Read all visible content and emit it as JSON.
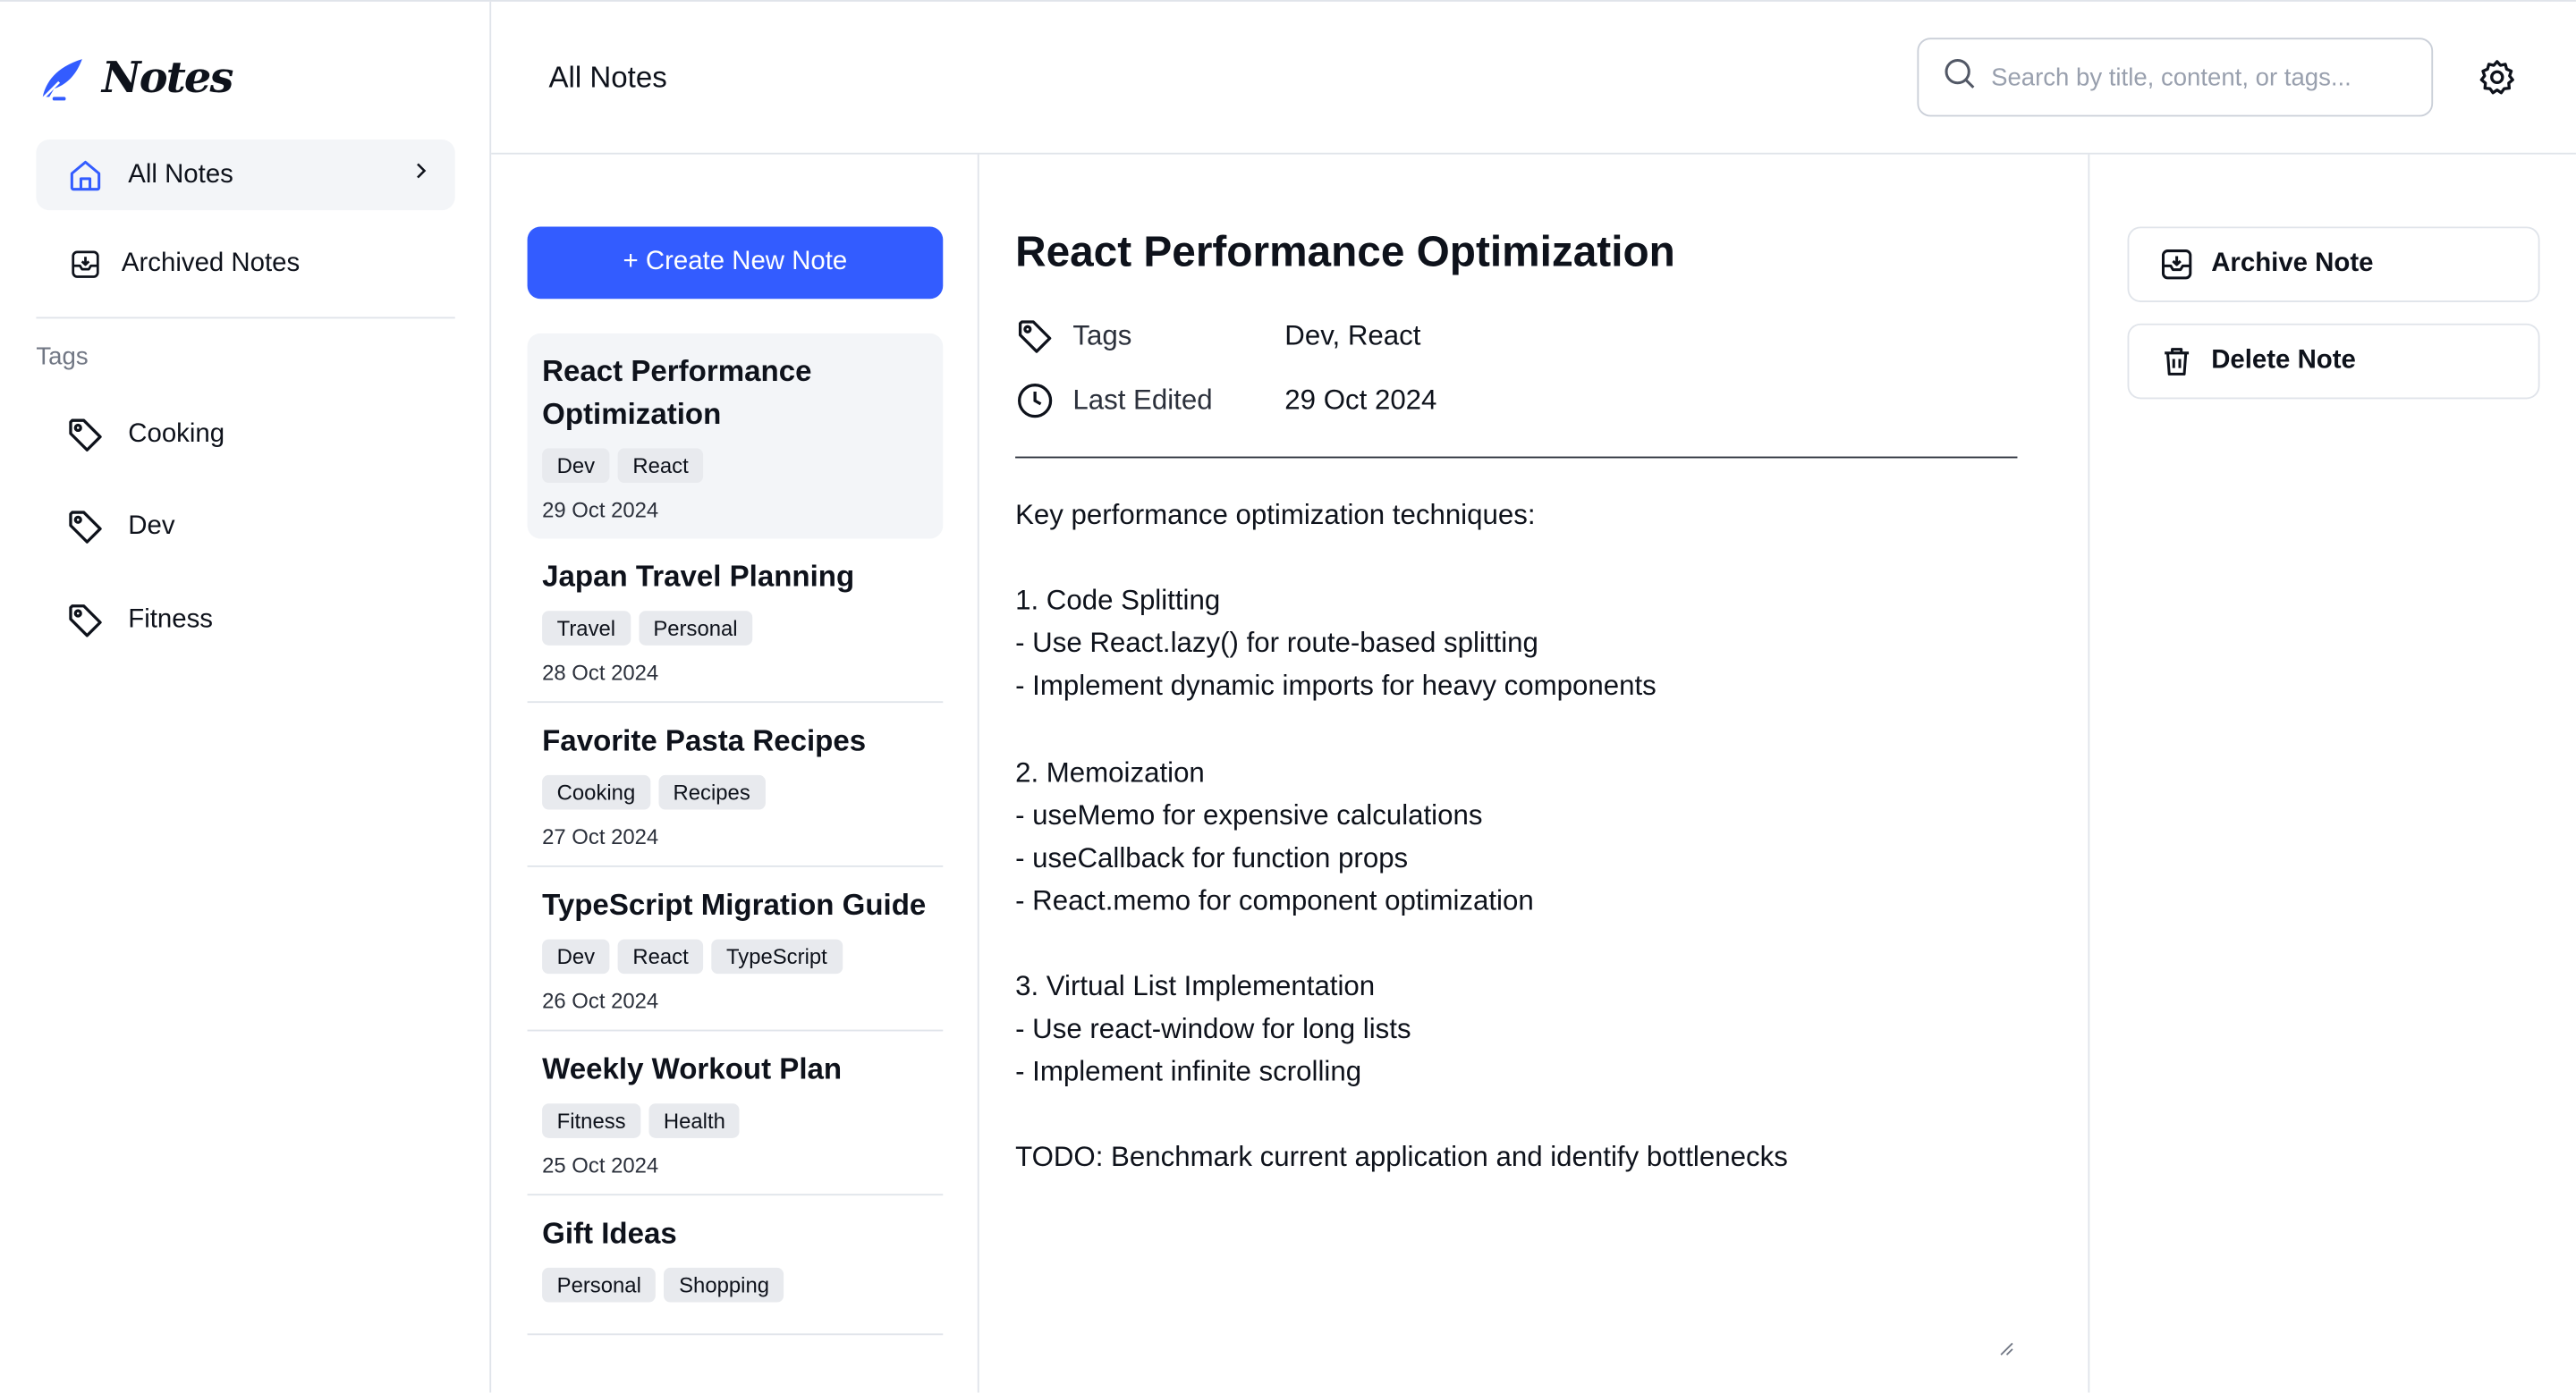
{
  "app": {
    "logo_text": "Notes"
  },
  "sidebar": {
    "nav": [
      {
        "label": "All Notes",
        "icon": "home-icon",
        "active": true
      },
      {
        "label": "Archived Notes",
        "icon": "archive-icon",
        "active": false
      }
    ],
    "tags_label": "Tags",
    "tags": [
      {
        "label": "Cooking",
        "icon": "tag-icon"
      },
      {
        "label": "Dev",
        "icon": "tag-icon"
      },
      {
        "label": "Fitness",
        "icon": "tag-icon"
      }
    ]
  },
  "header": {
    "title": "All Notes",
    "search_placeholder": "Search by title, content, or tags..."
  },
  "list": {
    "create_label": "+ Create New Note",
    "notes": [
      {
        "title": "React Performance Optimization",
        "tags": [
          "Dev",
          "React"
        ],
        "date": "29 Oct 2024",
        "selected": true
      },
      {
        "title": "Japan Travel Planning",
        "tags": [
          "Travel",
          "Personal"
        ],
        "date": "28 Oct 2024",
        "selected": false
      },
      {
        "title": "Favorite Pasta Recipes",
        "tags": [
          "Cooking",
          "Recipes"
        ],
        "date": "27 Oct 2024",
        "selected": false
      },
      {
        "title": "TypeScript Migration Guide",
        "tags": [
          "Dev",
          "React",
          "TypeScript"
        ],
        "date": "26 Oct 2024",
        "selected": false
      },
      {
        "title": "Weekly Workout Plan",
        "tags": [
          "Fitness",
          "Health"
        ],
        "date": "25 Oct 2024",
        "selected": false
      },
      {
        "title": "Gift Ideas",
        "tags": [
          "Personal",
          "Shopping"
        ],
        "date": "",
        "selected": false
      }
    ]
  },
  "editor": {
    "title": "React Performance Optimization",
    "tags_label": "Tags",
    "tags_value": "Dev, React",
    "edited_label": "Last Edited",
    "edited_value": "29 Oct 2024",
    "body": "Key performance optimization techniques:\n\n1. Code Splitting\n- Use React.lazy() for route-based splitting\n- Implement dynamic imports for heavy components\n\n2. Memoization\n- useMemo for expensive calculations\n- useCallback for function props\n- React.memo for component optimization\n\n3. Virtual List Implementation\n- Use react-window for long lists\n- Implement infinite scrolling\n\nTODO: Benchmark current application and identify bottlenecks"
  },
  "actions": {
    "archive_label": "Archive Note",
    "delete_label": "Delete Note"
  },
  "colors": {
    "accent": "#335cff",
    "text": "#0e121b",
    "muted": "#717784",
    "border": "#e0e4ea",
    "selected_bg": "#f3f5f8"
  }
}
